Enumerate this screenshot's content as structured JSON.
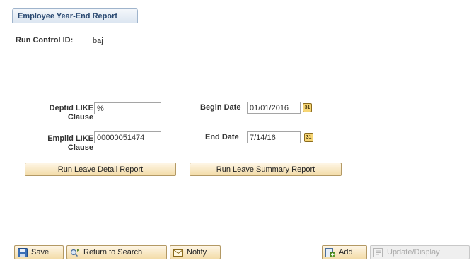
{
  "tab": {
    "label": "Employee Year-End Report"
  },
  "run_control": {
    "label": "Run Control ID:",
    "value": "baj"
  },
  "form": {
    "deptid_label": "Deptid LIKE\nClause",
    "deptid_value": "%",
    "emplid_label": "Emplid LIKE\nClause",
    "emplid_value": "00000051474",
    "begin_date_label": "Begin Date",
    "begin_date_value": "01/01/2016",
    "end_date_label": "End Date",
    "end_date_value": "7/14/16",
    "calendar_glyph": "31"
  },
  "actions": {
    "detail_label": "Run Leave Detail Report",
    "summary_label": "Run Leave Summary Report"
  },
  "toolbar": {
    "save_label": "Save",
    "return_label": "Return to Search",
    "notify_label": "Notify",
    "add_label": "Add",
    "update_label": "Update/Display"
  }
}
